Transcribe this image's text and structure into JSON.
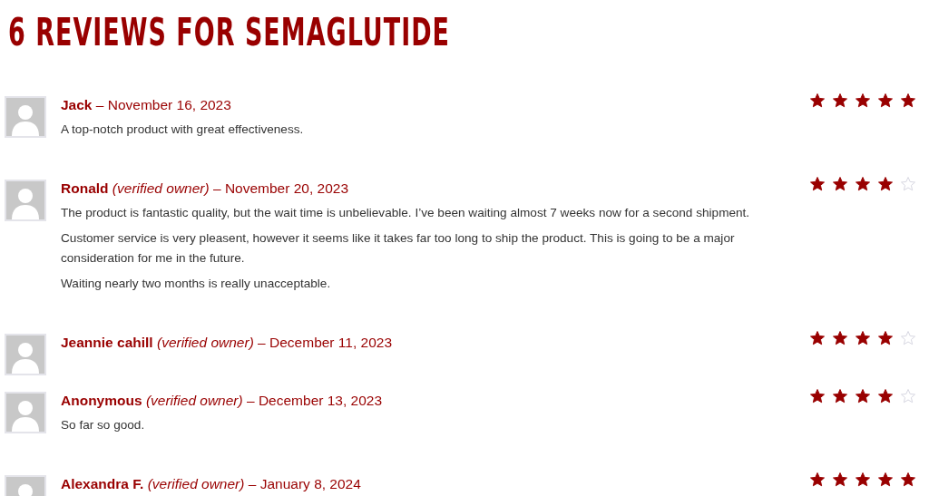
{
  "title": "6 REVIEWS FOR SEMAGLUTIDE",
  "reviews": [
    {
      "author": "Jack",
      "date": "– November 16, 2023",
      "stars": 5,
      "paragraphs": [
        "A top-notch product with great effectiveness."
      ]
    },
    {
      "author": "Ronald",
      "badge": "(verified owner)",
      "date": "– November 20, 2023",
      "stars": 4,
      "paragraphs": [
        "The product is fantastic quality, but the wait time is unbelievable. I’ve been waiting almost 7 weeks now for a second shipment.",
        "Customer service is very pleasent, however it seems like it takes far too long to ship the product. This is going to be a major consideration for me in the future.",
        "Waiting nearly two months is really unacceptable."
      ]
    },
    {
      "author": "Jeannie cahill",
      "badge": "(verified owner)",
      "date": "– December 11, 2023",
      "stars": 4
    },
    {
      "author": "Anonymous",
      "badge": "(verified owner)",
      "date": "– December 13, 2023",
      "stars": 4,
      "paragraphs": [
        "So far so good."
      ]
    },
    {
      "author": "Alexandra F.",
      "badge": "(verified owner)",
      "date": "– January 8, 2024",
      "stars": 5
    }
  ]
}
